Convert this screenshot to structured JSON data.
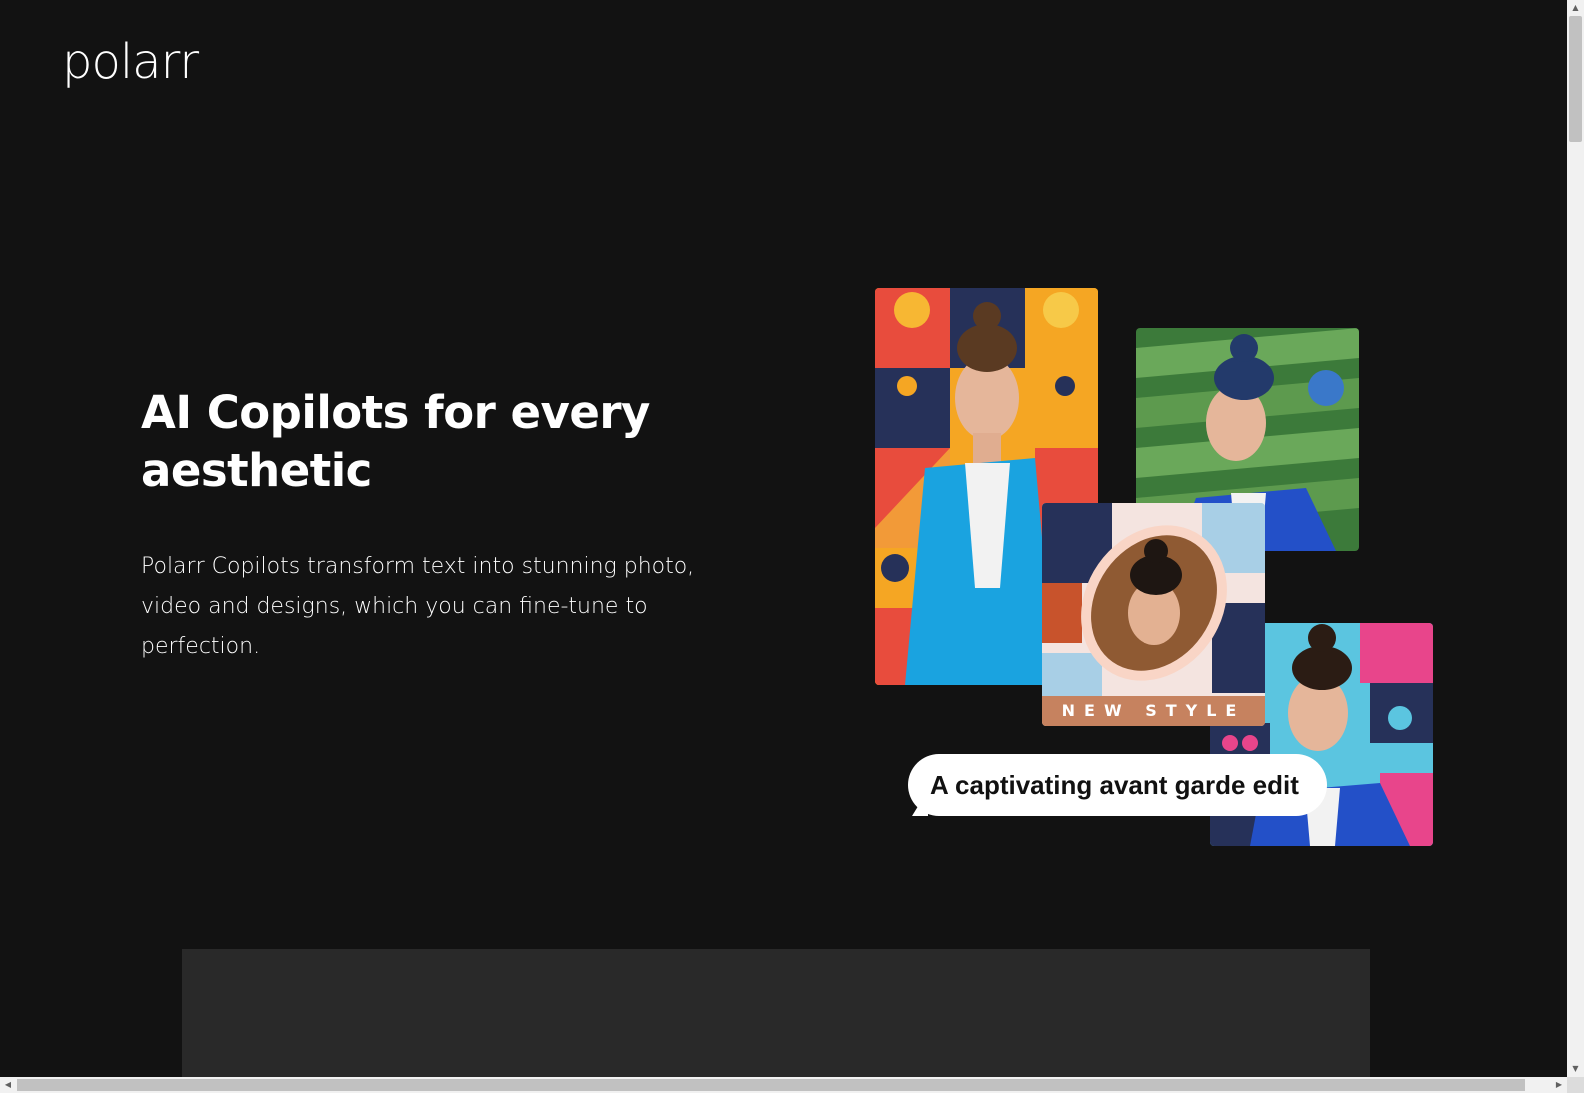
{
  "brand": {
    "logo_text": "polarr"
  },
  "hero": {
    "title": "AI Copilots for every aesthetic",
    "description": "Polarr Copilots transform text into stunning photo, video and designs, which you can fine-tune to perfection."
  },
  "showcase": {
    "style_caption": "NEW STYLE",
    "prompt_bubble": "A captivating avant garde edit"
  },
  "colors": {
    "background": "#121212",
    "panel": "#292929",
    "text": "#ffffff"
  },
  "scrollbars": {
    "up_arrow": "▲",
    "down_arrow": "▼",
    "left_arrow": "◀",
    "right_arrow": "▶"
  }
}
